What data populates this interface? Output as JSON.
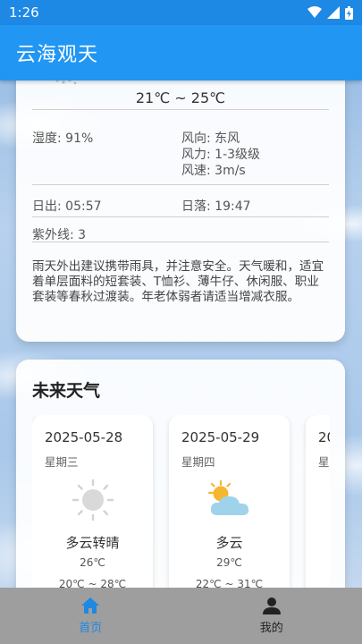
{
  "status": {
    "time": "1:26"
  },
  "app": {
    "title": "云海观天"
  },
  "today": {
    "temp_range": "21℃ ~ 25℃",
    "humidity": "湿度: 91%",
    "wind_dir": "风向: 东风",
    "wind_level": "风力: 1-3级级",
    "wind_speed": "风速: 3m/s",
    "sunrise": "日出: 05:57",
    "sunset": "日落: 19:47",
    "uv": "紫外线: 3",
    "advice": "雨天外出建议携带雨具，并注意安全。天气暖和，适宜着单层面料的短套装、T恤衫、薄牛仔、休闲服、职业套装等春秋过渡装。年老体弱者请适当增减衣服。"
  },
  "future": {
    "title": "未来天气",
    "days": [
      {
        "date": "2025-05-28",
        "weekday": "星期三",
        "cond": "多云转晴",
        "temp": "26℃",
        "range": "20℃ ~ 28℃",
        "icon": "sun-icon"
      },
      {
        "date": "2025-05-29",
        "weekday": "星期四",
        "cond": "多云",
        "temp": "29℃",
        "range": "22℃ ~ 31℃",
        "icon": "partly-cloudy-icon"
      },
      {
        "date": "20",
        "weekday": "星",
        "cond": "",
        "temp": "",
        "range": "",
        "icon": ""
      }
    ]
  },
  "nav": {
    "home_label": "首页",
    "mine_label": "我的"
  },
  "colors": {
    "primary": "#2196f3",
    "nav_bg": "#9e9e9e",
    "active": "#1e88e5"
  }
}
